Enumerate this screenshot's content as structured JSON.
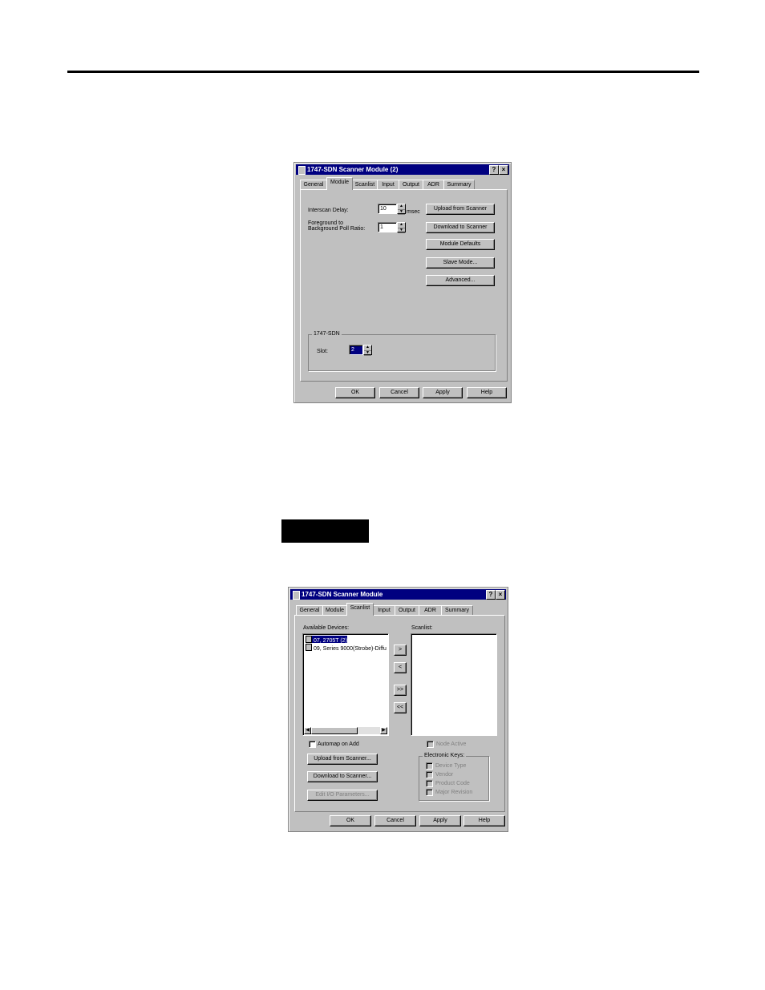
{
  "dialog1": {
    "title": "1747-SDN Scanner Module (2)",
    "tabs": [
      "General",
      "Module",
      "Scanlist",
      "Input",
      "Output",
      "ADR",
      "Summary"
    ],
    "active_tab": "Module",
    "interscan_delay_label": "Interscan Delay:",
    "interscan_delay_value": "10",
    "interscan_unit": "msec",
    "fg_bg_label_line1": "Foreground to",
    "fg_bg_label_line2": "Background Poll Ratio:",
    "fg_bg_value": "1",
    "buttons": {
      "upload": "Upload from Scanner",
      "download": "Download to Scanner",
      "defaults": "Module Defaults",
      "slave": "Slave Mode...",
      "advanced": "Advanced..."
    },
    "group_label": "1747-SDN",
    "slot_label": "Slot:",
    "slot_value": "2",
    "footer": {
      "ok": "OK",
      "cancel": "Cancel",
      "apply": "Apply",
      "help": "Help"
    }
  },
  "dialog2": {
    "title": "1747-SDN Scanner Module",
    "tabs": [
      "General",
      "Module",
      "Scanlist",
      "Input",
      "Output",
      "ADR",
      "Summary"
    ],
    "active_tab": "Scanlist",
    "available_label": "Available Devices:",
    "scanlist_label": "Scanlist:",
    "available_devices": [
      "07, 2705T (2)",
      "09, Series 9000(Strobe)-Diffu"
    ],
    "arrows": {
      "add": ">",
      "remove": "<",
      "add_all": ">>",
      "remove_all": "<<"
    },
    "automap_label": "Automap on Add",
    "node_active_label": "Node Active",
    "upload": "Upload from Scanner...",
    "download": "Download to Scanner...",
    "edit_io": "Edit I/O Parameters...",
    "electronic_keys_label": "Electronic Keys:",
    "keys": [
      "Device Type",
      "Vendor",
      "Product Code",
      "Major Revision"
    ],
    "footer": {
      "ok": "OK",
      "cancel": "Cancel",
      "apply": "Apply",
      "help": "Help"
    }
  }
}
